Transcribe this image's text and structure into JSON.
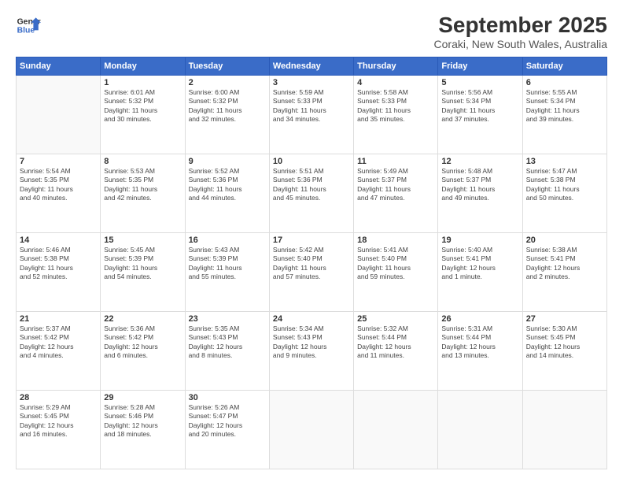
{
  "logo": {
    "line1": "General",
    "line2": "Blue"
  },
  "title": "September 2025",
  "location": "Coraki, New South Wales, Australia",
  "days_header": [
    "Sunday",
    "Monday",
    "Tuesday",
    "Wednesday",
    "Thursday",
    "Friday",
    "Saturday"
  ],
  "weeks": [
    [
      {
        "day": "",
        "info": ""
      },
      {
        "day": "1",
        "info": "Sunrise: 6:01 AM\nSunset: 5:32 PM\nDaylight: 11 hours\nand 30 minutes."
      },
      {
        "day": "2",
        "info": "Sunrise: 6:00 AM\nSunset: 5:32 PM\nDaylight: 11 hours\nand 32 minutes."
      },
      {
        "day": "3",
        "info": "Sunrise: 5:59 AM\nSunset: 5:33 PM\nDaylight: 11 hours\nand 34 minutes."
      },
      {
        "day": "4",
        "info": "Sunrise: 5:58 AM\nSunset: 5:33 PM\nDaylight: 11 hours\nand 35 minutes."
      },
      {
        "day": "5",
        "info": "Sunrise: 5:56 AM\nSunset: 5:34 PM\nDaylight: 11 hours\nand 37 minutes."
      },
      {
        "day": "6",
        "info": "Sunrise: 5:55 AM\nSunset: 5:34 PM\nDaylight: 11 hours\nand 39 minutes."
      }
    ],
    [
      {
        "day": "7",
        "info": "Sunrise: 5:54 AM\nSunset: 5:35 PM\nDaylight: 11 hours\nand 40 minutes."
      },
      {
        "day": "8",
        "info": "Sunrise: 5:53 AM\nSunset: 5:35 PM\nDaylight: 11 hours\nand 42 minutes."
      },
      {
        "day": "9",
        "info": "Sunrise: 5:52 AM\nSunset: 5:36 PM\nDaylight: 11 hours\nand 44 minutes."
      },
      {
        "day": "10",
        "info": "Sunrise: 5:51 AM\nSunset: 5:36 PM\nDaylight: 11 hours\nand 45 minutes."
      },
      {
        "day": "11",
        "info": "Sunrise: 5:49 AM\nSunset: 5:37 PM\nDaylight: 11 hours\nand 47 minutes."
      },
      {
        "day": "12",
        "info": "Sunrise: 5:48 AM\nSunset: 5:37 PM\nDaylight: 11 hours\nand 49 minutes."
      },
      {
        "day": "13",
        "info": "Sunrise: 5:47 AM\nSunset: 5:38 PM\nDaylight: 11 hours\nand 50 minutes."
      }
    ],
    [
      {
        "day": "14",
        "info": "Sunrise: 5:46 AM\nSunset: 5:38 PM\nDaylight: 11 hours\nand 52 minutes."
      },
      {
        "day": "15",
        "info": "Sunrise: 5:45 AM\nSunset: 5:39 PM\nDaylight: 11 hours\nand 54 minutes."
      },
      {
        "day": "16",
        "info": "Sunrise: 5:43 AM\nSunset: 5:39 PM\nDaylight: 11 hours\nand 55 minutes."
      },
      {
        "day": "17",
        "info": "Sunrise: 5:42 AM\nSunset: 5:40 PM\nDaylight: 11 hours\nand 57 minutes."
      },
      {
        "day": "18",
        "info": "Sunrise: 5:41 AM\nSunset: 5:40 PM\nDaylight: 11 hours\nand 59 minutes."
      },
      {
        "day": "19",
        "info": "Sunrise: 5:40 AM\nSunset: 5:41 PM\nDaylight: 12 hours\nand 1 minute."
      },
      {
        "day": "20",
        "info": "Sunrise: 5:38 AM\nSunset: 5:41 PM\nDaylight: 12 hours\nand 2 minutes."
      }
    ],
    [
      {
        "day": "21",
        "info": "Sunrise: 5:37 AM\nSunset: 5:42 PM\nDaylight: 12 hours\nand 4 minutes."
      },
      {
        "day": "22",
        "info": "Sunrise: 5:36 AM\nSunset: 5:42 PM\nDaylight: 12 hours\nand 6 minutes."
      },
      {
        "day": "23",
        "info": "Sunrise: 5:35 AM\nSunset: 5:43 PM\nDaylight: 12 hours\nand 8 minutes."
      },
      {
        "day": "24",
        "info": "Sunrise: 5:34 AM\nSunset: 5:43 PM\nDaylight: 12 hours\nand 9 minutes."
      },
      {
        "day": "25",
        "info": "Sunrise: 5:32 AM\nSunset: 5:44 PM\nDaylight: 12 hours\nand 11 minutes."
      },
      {
        "day": "26",
        "info": "Sunrise: 5:31 AM\nSunset: 5:44 PM\nDaylight: 12 hours\nand 13 minutes."
      },
      {
        "day": "27",
        "info": "Sunrise: 5:30 AM\nSunset: 5:45 PM\nDaylight: 12 hours\nand 14 minutes."
      }
    ],
    [
      {
        "day": "28",
        "info": "Sunrise: 5:29 AM\nSunset: 5:45 PM\nDaylight: 12 hours\nand 16 minutes."
      },
      {
        "day": "29",
        "info": "Sunrise: 5:28 AM\nSunset: 5:46 PM\nDaylight: 12 hours\nand 18 minutes."
      },
      {
        "day": "30",
        "info": "Sunrise: 5:26 AM\nSunset: 5:47 PM\nDaylight: 12 hours\nand 20 minutes."
      },
      {
        "day": "",
        "info": ""
      },
      {
        "day": "",
        "info": ""
      },
      {
        "day": "",
        "info": ""
      },
      {
        "day": "",
        "info": ""
      }
    ]
  ]
}
